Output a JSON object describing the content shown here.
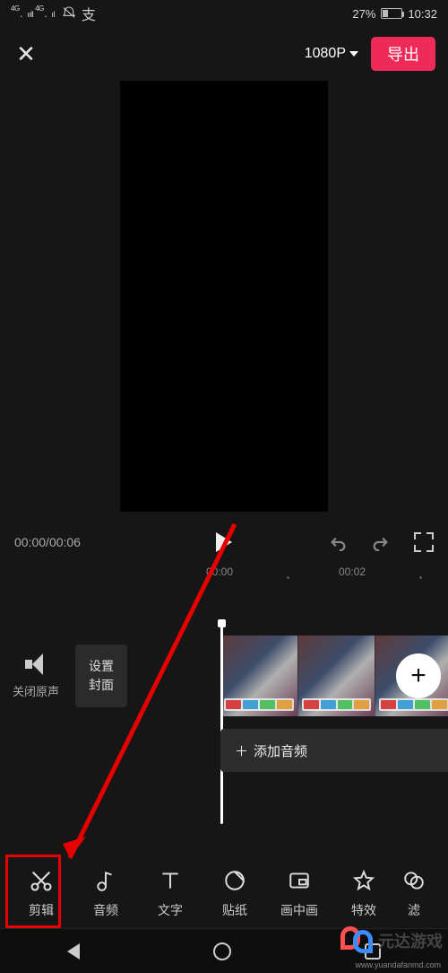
{
  "status": {
    "net1": "4G",
    "net2": "4G",
    "battery_pct": "27%",
    "time": "10:32"
  },
  "header": {
    "resolution": "1080P",
    "export": "导出"
  },
  "playback": {
    "elapsed": "00:00",
    "total": "00:06"
  },
  "ruler": {
    "t0": "00:00",
    "t1": "00:02"
  },
  "timeline": {
    "mute_label": "关闭原声",
    "cover_btn_l1": "设置",
    "cover_btn_l2": "封面",
    "add_audio": "添加音频",
    "plus": "+"
  },
  "tools": [
    {
      "id": "cut",
      "label": "剪辑"
    },
    {
      "id": "audio",
      "label": "音频"
    },
    {
      "id": "text",
      "label": "文字"
    },
    {
      "id": "stkr",
      "label": "贴纸"
    },
    {
      "id": "pip",
      "label": "画中画"
    },
    {
      "id": "fx",
      "label": "特效"
    },
    {
      "id": "filter",
      "label": "滤"
    }
  ],
  "watermark": {
    "name": "元达游戏",
    "url": "www.yuandafanmd.com"
  }
}
